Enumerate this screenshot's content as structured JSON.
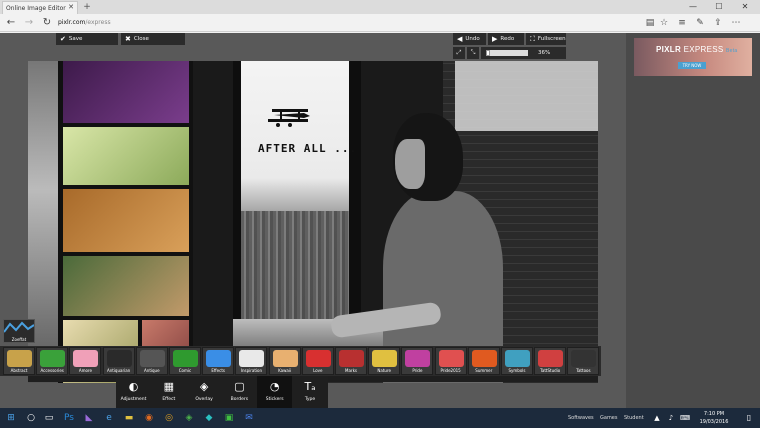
{
  "browser": {
    "tab_title": "Online Image Editor | Pi",
    "tab_close": "✕",
    "new_tab": "+",
    "url_host": "pixlr.com",
    "url_path": "/express",
    "win_min": "—",
    "win_max": "☐",
    "win_close": "✕"
  },
  "editor": {
    "save_label": "Save",
    "close_label": "Close",
    "undo_label": "Undo",
    "redo_label": "Redo",
    "fullscreen_label": "Fullscreen",
    "zoom_percent": 36,
    "zoom_text": "36%"
  },
  "canvas": {
    "caption": "AFTER ALL ..."
  },
  "ad": {
    "title_a": "PIXLR",
    "title_b": "EXPRESS",
    "suffix": "Beta",
    "button": "TRY NOW"
  },
  "effect_mini": {
    "label": "Zoeffat"
  },
  "stickers": [
    {
      "label": "Abstract",
      "color": "#c8a24a"
    },
    {
      "label": "Accessories",
      "color": "#3aa13a"
    },
    {
      "label": "Amore",
      "color": "#f0a0b8"
    },
    {
      "label": "Antiquarian",
      "color": "#2a2a2a"
    },
    {
      "label": "Antique",
      "color": "#555555"
    },
    {
      "label": "Comic",
      "color": "#2f9a2f"
    },
    {
      "label": "Effects",
      "color": "#3a8ee6"
    },
    {
      "label": "Inspiration",
      "color": "#e9e9e9"
    },
    {
      "label": "Kawaii",
      "color": "#e8b070"
    },
    {
      "label": "Love",
      "color": "#d83030"
    },
    {
      "label": "Marks",
      "color": "#b83030"
    },
    {
      "label": "Nature",
      "color": "#e0c040"
    },
    {
      "label": "Pride",
      "color": "#c040a0"
    },
    {
      "label": "Pride2015",
      "color": "#e05050"
    },
    {
      "label": "Summer",
      "color": "#e05a20"
    },
    {
      "label": "Symbols",
      "color": "#40a0c0"
    },
    {
      "label": "TattStudio",
      "color": "#d04040"
    },
    {
      "label": "Tattoos",
      "color": "#333333"
    }
  ],
  "tools": [
    {
      "label": "Adjustment",
      "icon": "◐"
    },
    {
      "label": "Effect",
      "icon": "▦"
    },
    {
      "label": "Overlay",
      "icon": "◈"
    },
    {
      "label": "Borders",
      "icon": "▢"
    },
    {
      "label": "Stickers",
      "icon": "◔"
    },
    {
      "label": "Type",
      "icon": "Tₐ"
    }
  ],
  "taskbar": {
    "tray_1": "Softwaves",
    "tray_2": "Games",
    "tray_3": "Student",
    "time": "7:10 PM",
    "date": "19/03/2016"
  }
}
